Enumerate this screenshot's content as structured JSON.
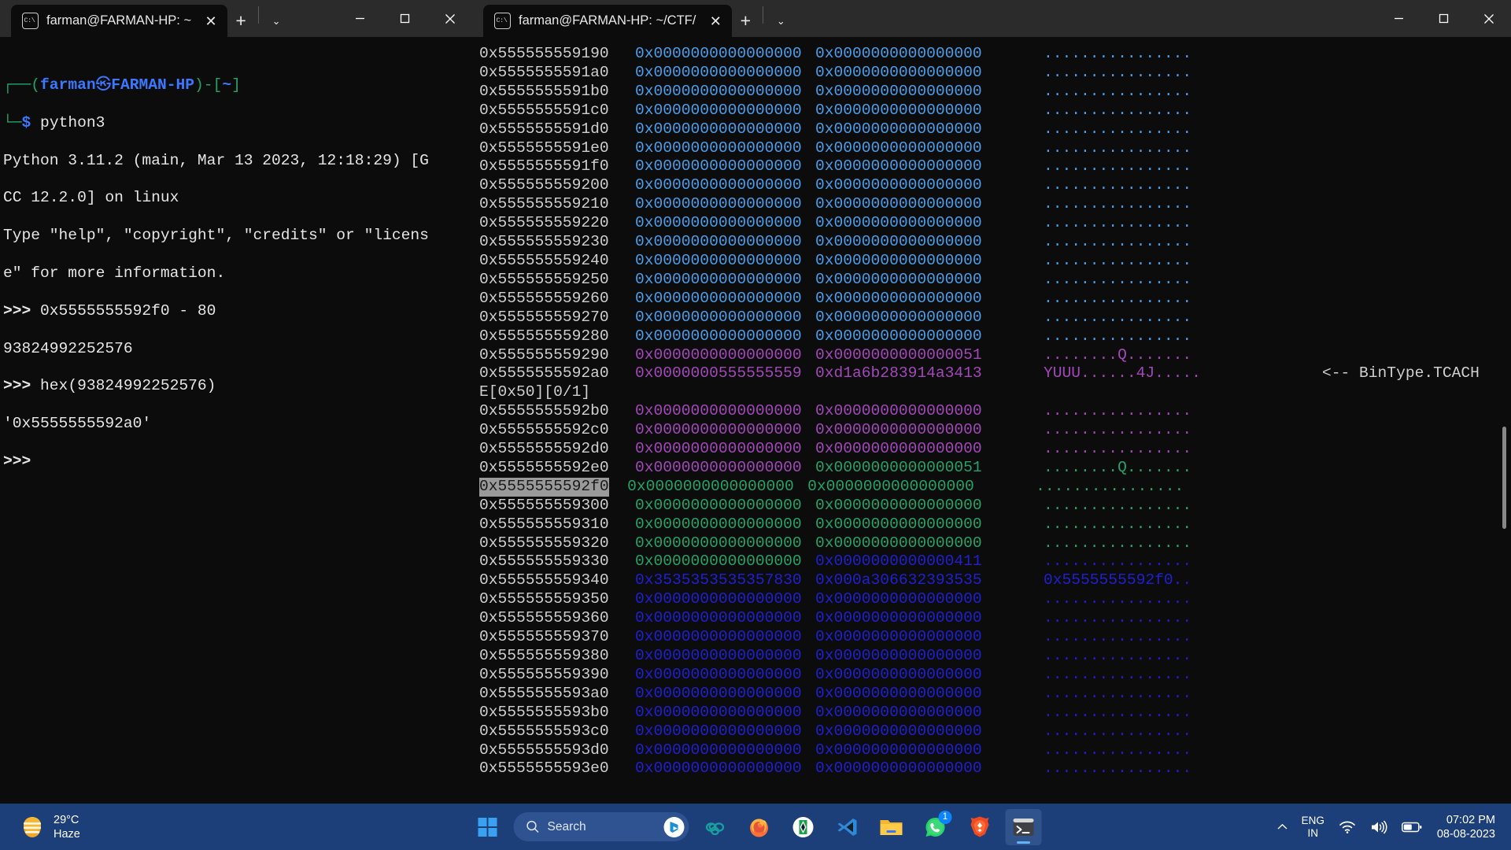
{
  "left_window": {
    "tab": {
      "title": "farman@FARMAN-HP: ~",
      "close_label": "✕",
      "new_label": "+",
      "dropdown_label": "⌄"
    },
    "controls": {
      "minimize": "minimize-button",
      "maximize": "maximize-button",
      "close": "close-button"
    },
    "terminal": {
      "prompt_user": "farman",
      "prompt_host": "FARMAN-HP",
      "prompt_path": "~",
      "line_prompt_prefix": "┌──(",
      "line_prompt_mid": ")-[",
      "line_prompt_suffix": "]",
      "line2_branch": "└─",
      "dollar": "$",
      "command": " python3",
      "out1": "Python 3.11.2 (main, Mar 13 2023, 12:18:29) [G",
      "out2": "CC 12.2.0] on linux",
      "out3": "Type \"help\", \"copyright\", \"credits\" or \"licens",
      "out4": "e\" for more information.",
      "ps1": ">>>",
      "cmd1": " 0x5555555592f0 - 80",
      "res1": "93824992252576",
      "cmd2": " hex(93824992252576)",
      "res2": "'0x5555555592a0'",
      "ps_last": ">>>"
    }
  },
  "right_window": {
    "tab": {
      "title": "farman@FARMAN-HP: ~/CTF/",
      "close_label": "✕",
      "new_label": "+",
      "dropdown_label": "⌄"
    },
    "annotation": "<-- BinType.TCACH",
    "continuation_line": "E[0x50][0/1]",
    "hexdump": [
      {
        "addr": "0x555555559190",
        "w1": "0x0000000000000000",
        "w2": "0x0000000000000000",
        "ascii": "................",
        "color": "blue"
      },
      {
        "addr": "0x5555555591a0",
        "w1": "0x0000000000000000",
        "w2": "0x0000000000000000",
        "ascii": "................",
        "color": "blue"
      },
      {
        "addr": "0x5555555591b0",
        "w1": "0x0000000000000000",
        "w2": "0x0000000000000000",
        "ascii": "................",
        "color": "blue"
      },
      {
        "addr": "0x5555555591c0",
        "w1": "0x0000000000000000",
        "w2": "0x0000000000000000",
        "ascii": "................",
        "color": "blue"
      },
      {
        "addr": "0x5555555591d0",
        "w1": "0x0000000000000000",
        "w2": "0x0000000000000000",
        "ascii": "................",
        "color": "blue"
      },
      {
        "addr": "0x5555555591e0",
        "w1": "0x0000000000000000",
        "w2": "0x0000000000000000",
        "ascii": "................",
        "color": "blue"
      },
      {
        "addr": "0x5555555591f0",
        "w1": "0x0000000000000000",
        "w2": "0x0000000000000000",
        "ascii": "................",
        "color": "blue"
      },
      {
        "addr": "0x555555559200",
        "w1": "0x0000000000000000",
        "w2": "0x0000000000000000",
        "ascii": "................",
        "color": "blue"
      },
      {
        "addr": "0x555555559210",
        "w1": "0x0000000000000000",
        "w2": "0x0000000000000000",
        "ascii": "................",
        "color": "blue"
      },
      {
        "addr": "0x555555559220",
        "w1": "0x0000000000000000",
        "w2": "0x0000000000000000",
        "ascii": "................",
        "color": "blue"
      },
      {
        "addr": "0x555555559230",
        "w1": "0x0000000000000000",
        "w2": "0x0000000000000000",
        "ascii": "................",
        "color": "blue"
      },
      {
        "addr": "0x555555559240",
        "w1": "0x0000000000000000",
        "w2": "0x0000000000000000",
        "ascii": "................",
        "color": "blue"
      },
      {
        "addr": "0x555555559250",
        "w1": "0x0000000000000000",
        "w2": "0x0000000000000000",
        "ascii": "................",
        "color": "blue"
      },
      {
        "addr": "0x555555559260",
        "w1": "0x0000000000000000",
        "w2": "0x0000000000000000",
        "ascii": "................",
        "color": "blue"
      },
      {
        "addr": "0x555555559270",
        "w1": "0x0000000000000000",
        "w2": "0x0000000000000000",
        "ascii": "................",
        "color": "blue"
      },
      {
        "addr": "0x555555559280",
        "w1": "0x0000000000000000",
        "w2": "0x0000000000000000",
        "ascii": "................",
        "color": "blue"
      },
      {
        "addr": "0x555555559290",
        "w1": "0x0000000000000000",
        "w2": "0x0000000000000051",
        "ascii": "........Q.......",
        "color": "magenta"
      },
      {
        "addr": "0x5555555592a0",
        "w1": "0x0000000555555559",
        "w2": "0xd1a6b283914a3413",
        "ascii": "YUUU......4J.....",
        "color": "magenta",
        "annotated": true
      },
      {
        "addr": "0x5555555592b0",
        "w1": "0x0000000000000000",
        "w2": "0x0000000000000000",
        "ascii": "................",
        "color": "magenta"
      },
      {
        "addr": "0x5555555592c0",
        "w1": "0x0000000000000000",
        "w2": "0x0000000000000000",
        "ascii": "................",
        "color": "magenta"
      },
      {
        "addr": "0x5555555592d0",
        "w1": "0x0000000000000000",
        "w2": "0x0000000000000000",
        "ascii": "................",
        "color": "magenta"
      },
      {
        "addr": "0x5555555592e0",
        "w1": "0x0000000000000000",
        "w2": "0x0000000000000051",
        "ascii": "........Q.......",
        "color": "magenta_green"
      },
      {
        "addr": "0x5555555592f0",
        "w1": "0x0000000000000000",
        "w2": "0x0000000000000000",
        "ascii": "................",
        "color": "green",
        "selected": true
      },
      {
        "addr": "0x555555559300",
        "w1": "0x0000000000000000",
        "w2": "0x0000000000000000",
        "ascii": "................",
        "color": "green"
      },
      {
        "addr": "0x555555559310",
        "w1": "0x0000000000000000",
        "w2": "0x0000000000000000",
        "ascii": "................",
        "color": "green"
      },
      {
        "addr": "0x555555559320",
        "w1": "0x0000000000000000",
        "w2": "0x0000000000000000",
        "ascii": "................",
        "color": "green"
      },
      {
        "addr": "0x555555559330",
        "w1": "0x0000000000000000",
        "w2": "0x0000000000000411",
        "ascii": "................",
        "color": "green_darkblue"
      },
      {
        "addr": "0x555555559340",
        "w1": "0x3535353535357830",
        "w2": "0x000a306632393535",
        "ascii": "0x5555555592f0..",
        "color": "darkblue"
      },
      {
        "addr": "0x555555559350",
        "w1": "0x0000000000000000",
        "w2": "0x0000000000000000",
        "ascii": "................",
        "color": "darkblue"
      },
      {
        "addr": "0x555555559360",
        "w1": "0x0000000000000000",
        "w2": "0x0000000000000000",
        "ascii": "................",
        "color": "darkblue"
      },
      {
        "addr": "0x555555559370",
        "w1": "0x0000000000000000",
        "w2": "0x0000000000000000",
        "ascii": "................",
        "color": "darkblue"
      },
      {
        "addr": "0x555555559380",
        "w1": "0x0000000000000000",
        "w2": "0x0000000000000000",
        "ascii": "................",
        "color": "darkblue"
      },
      {
        "addr": "0x555555559390",
        "w1": "0x0000000000000000",
        "w2": "0x0000000000000000",
        "ascii": "................",
        "color": "darkblue"
      },
      {
        "addr": "0x5555555593a0",
        "w1": "0x0000000000000000",
        "w2": "0x0000000000000000",
        "ascii": "................",
        "color": "darkblue"
      },
      {
        "addr": "0x5555555593b0",
        "w1": "0x0000000000000000",
        "w2": "0x0000000000000000",
        "ascii": "................",
        "color": "darkblue"
      },
      {
        "addr": "0x5555555593c0",
        "w1": "0x0000000000000000",
        "w2": "0x0000000000000000",
        "ascii": "................",
        "color": "darkblue"
      },
      {
        "addr": "0x5555555593d0",
        "w1": "0x0000000000000000",
        "w2": "0x0000000000000000",
        "ascii": "................",
        "color": "darkblue"
      },
      {
        "addr": "0x5555555593e0",
        "w1": "0x0000000000000000",
        "w2": "0x0000000000000000",
        "ascii": "................",
        "color": "darkblue"
      }
    ]
  },
  "taskbar": {
    "weather": {
      "temperature": "29°C",
      "condition": "Haze",
      "icon": "haze-weather-icon"
    },
    "start": "start-button",
    "search": {
      "placeholder": "Search",
      "icon": "search-icon",
      "assistant_icon": "bing-chat-icon"
    },
    "apps": [
      {
        "name": "copilot-icon",
        "label": "Copilot"
      },
      {
        "name": "firefox-icon",
        "label": "Firefox"
      },
      {
        "name": "anydesk-icon",
        "label": "AnyDesk"
      },
      {
        "name": "vscode-icon",
        "label": "Visual Studio Code"
      },
      {
        "name": "file-explorer-icon",
        "label": "File Explorer"
      },
      {
        "name": "whatsapp-icon",
        "label": "WhatsApp",
        "badge": "1"
      },
      {
        "name": "brave-icon",
        "label": "Brave"
      },
      {
        "name": "terminal-icon",
        "label": "Terminal",
        "active": true
      }
    ],
    "tray": {
      "chevron": "show-hidden-icons",
      "language_line1": "ENG",
      "language_line2": "IN",
      "wifi": "wifi-icon",
      "volume": "volume-icon",
      "battery": "battery-icon",
      "time": "07:02 PM",
      "date": "08-08-2023"
    }
  },
  "colors": {
    "accent": "#3b78ff",
    "taskbar": "#1c3f79",
    "terminal_bg": "#0c0c0c",
    "titlebar": "#2b2b2b"
  }
}
